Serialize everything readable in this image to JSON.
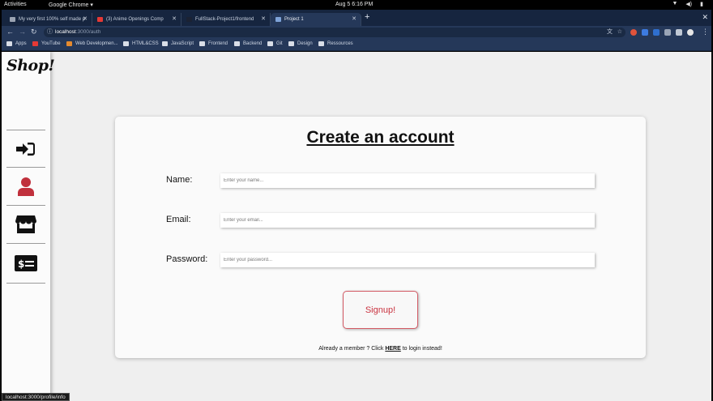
{
  "os_bar": {
    "activities": "Activities",
    "app_name": "Google Chrome ▾",
    "clock": "Aug 5   6:16 PM"
  },
  "tabs": [
    {
      "label": "My very first 100% self made p",
      "active": false,
      "favicon_color": "#9aa3b2"
    },
    {
      "label": "(3) Anime Openings Comp",
      "active": false,
      "favicon_color": "#e53935"
    },
    {
      "label": "FullStack-Project1/frontend",
      "active": false,
      "favicon_color": "#1b2233"
    },
    {
      "label": "Project 1",
      "active": true,
      "favicon_color": "#7ea3d8"
    }
  ],
  "address": {
    "host": "localhost",
    "path": ":3000/auth"
  },
  "bookmarks": [
    {
      "label": "Apps",
      "icon": "apps-grid-icon"
    },
    {
      "label": "YouTube",
      "icon": "youtube-icon"
    },
    {
      "label": "Web Developmen...",
      "icon": "web-icon"
    },
    {
      "label": "HTML&CSS",
      "icon": "folder-icon"
    },
    {
      "label": "JavaScript",
      "icon": "folder-icon"
    },
    {
      "label": "Frontend",
      "icon": "folder-icon"
    },
    {
      "label": "Backend",
      "icon": "folder-icon"
    },
    {
      "label": "Git",
      "icon": "folder-icon"
    },
    {
      "label": "Design",
      "icon": "folder-icon"
    },
    {
      "label": "Ressources",
      "icon": "folder-icon"
    }
  ],
  "sidebar": {
    "logo": "Shop!",
    "items": [
      {
        "name": "login",
        "icon": "sign-in-icon",
        "color": "#111111"
      },
      {
        "name": "profile",
        "icon": "user-icon",
        "color": "#c0303c"
      },
      {
        "name": "store",
        "icon": "store-icon",
        "color": "#111111"
      },
      {
        "name": "billing",
        "icon": "money-check-icon",
        "color": "#111111"
      }
    ]
  },
  "form": {
    "title": "Create an account",
    "fields": [
      {
        "label": "Name:",
        "placeholder": "Enter your name..."
      },
      {
        "label": "Email:",
        "placeholder": "Enter your email..."
      },
      {
        "label": "Password:",
        "placeholder": "Enter your password..."
      }
    ],
    "submit_label": "Signup!",
    "footer_before": "Already a member ? Click ",
    "footer_link": "HERE",
    "footer_after": " to login instead!"
  },
  "status_url": "localhost:3000/profile/info"
}
